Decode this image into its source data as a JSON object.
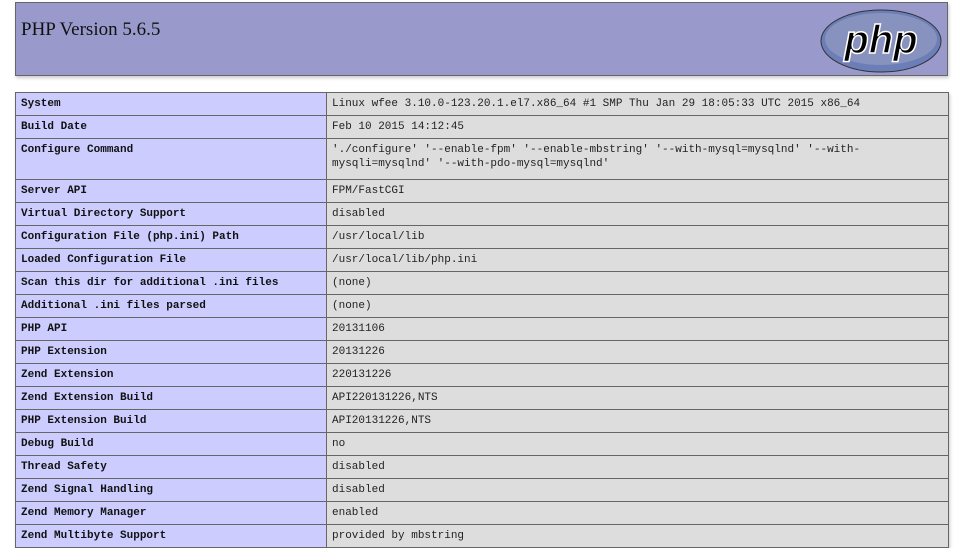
{
  "header": {
    "title": "PHP Version 5.6.5",
    "logo_text": "php"
  },
  "rows": [
    {
      "key": "System",
      "value": "Linux wfee 3.10.0-123.20.1.el7.x86_64 #1 SMP Thu Jan 29 18:05:33 UTC 2015 x86_64"
    },
    {
      "key": "Build Date",
      "value": "Feb 10 2015 14:12:45"
    },
    {
      "key": "Configure Command",
      "value": "'./configure' '--enable-fpm' '--enable-mbstring' '--with-mysql=mysqlnd' '--with-mysqli=mysqlnd' '--with-pdo-mysql=mysqlnd'"
    },
    {
      "key": "Server API",
      "value": "FPM/FastCGI"
    },
    {
      "key": "Virtual Directory Support",
      "value": "disabled"
    },
    {
      "key": "Configuration File (php.ini) Path",
      "value": "/usr/local/lib"
    },
    {
      "key": "Loaded Configuration File",
      "value": "/usr/local/lib/php.ini"
    },
    {
      "key": "Scan this dir for additional .ini files",
      "value": "(none)"
    },
    {
      "key": "Additional .ini files parsed",
      "value": "(none)"
    },
    {
      "key": "PHP API",
      "value": "20131106"
    },
    {
      "key": "PHP Extension",
      "value": "20131226"
    },
    {
      "key": "Zend Extension",
      "value": "220131226"
    },
    {
      "key": "Zend Extension Build",
      "value": "API220131226,NTS"
    },
    {
      "key": "PHP Extension Build",
      "value": "API20131226,NTS"
    },
    {
      "key": "Debug Build",
      "value": "no"
    },
    {
      "key": "Thread Safety",
      "value": "disabled"
    },
    {
      "key": "Zend Signal Handling",
      "value": "disabled"
    },
    {
      "key": "Zend Memory Manager",
      "value": "enabled"
    },
    {
      "key": "Zend Multibyte Support",
      "value": "provided by mbstring"
    }
  ]
}
